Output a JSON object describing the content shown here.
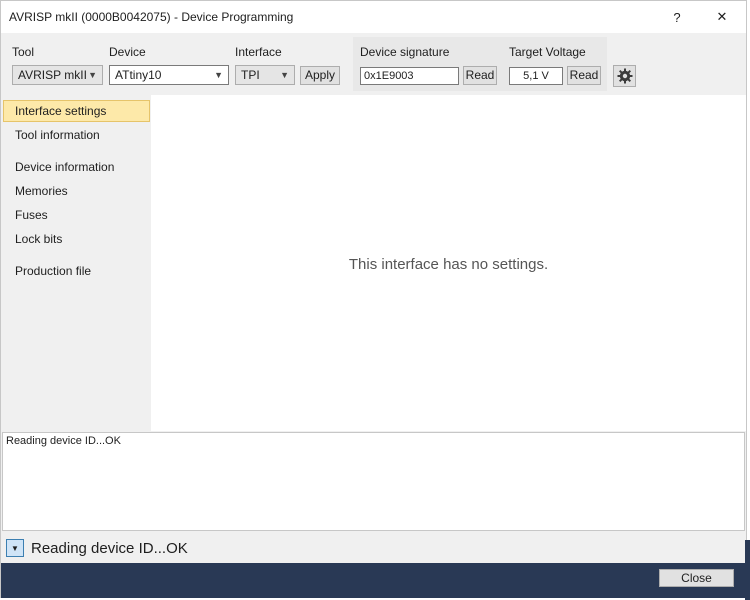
{
  "window": {
    "title": "AVRISP mkII (0000B0042075) - Device Programming",
    "help_glyph": "?",
    "close_glyph": "✕"
  },
  "toolbar": {
    "tool_label": "Tool",
    "tool_value": "AVRISP mkII",
    "device_label": "Device",
    "device_value": "ATtiny10",
    "interface_label": "Interface",
    "interface_value": "TPI",
    "apply_label": "Apply",
    "signature_label": "Device signature",
    "signature_value": "0x1E9003",
    "signature_read_label": "Read",
    "voltage_label": "Target Voltage",
    "voltage_value": "5,1 V",
    "voltage_read_label": "Read",
    "settings_icon": "gear-icon"
  },
  "sidebar": {
    "items": [
      {
        "label": "Interface settings",
        "active": true
      },
      {
        "label": "Tool information"
      },
      {
        "label": "Device information"
      },
      {
        "label": "Memories"
      },
      {
        "label": "Fuses"
      },
      {
        "label": "Lock bits"
      },
      {
        "label": "Production file"
      }
    ]
  },
  "main": {
    "message": "This interface has no settings."
  },
  "log": {
    "text": "Reading device ID...OK"
  },
  "status": {
    "text": "Reading device ID...OK",
    "toggle_icon": "chevron-down-icon"
  },
  "footer": {
    "close_label": "Close"
  },
  "colors": {
    "footer_bg": "#293955",
    "active_item_bg": "#fde9a9"
  }
}
